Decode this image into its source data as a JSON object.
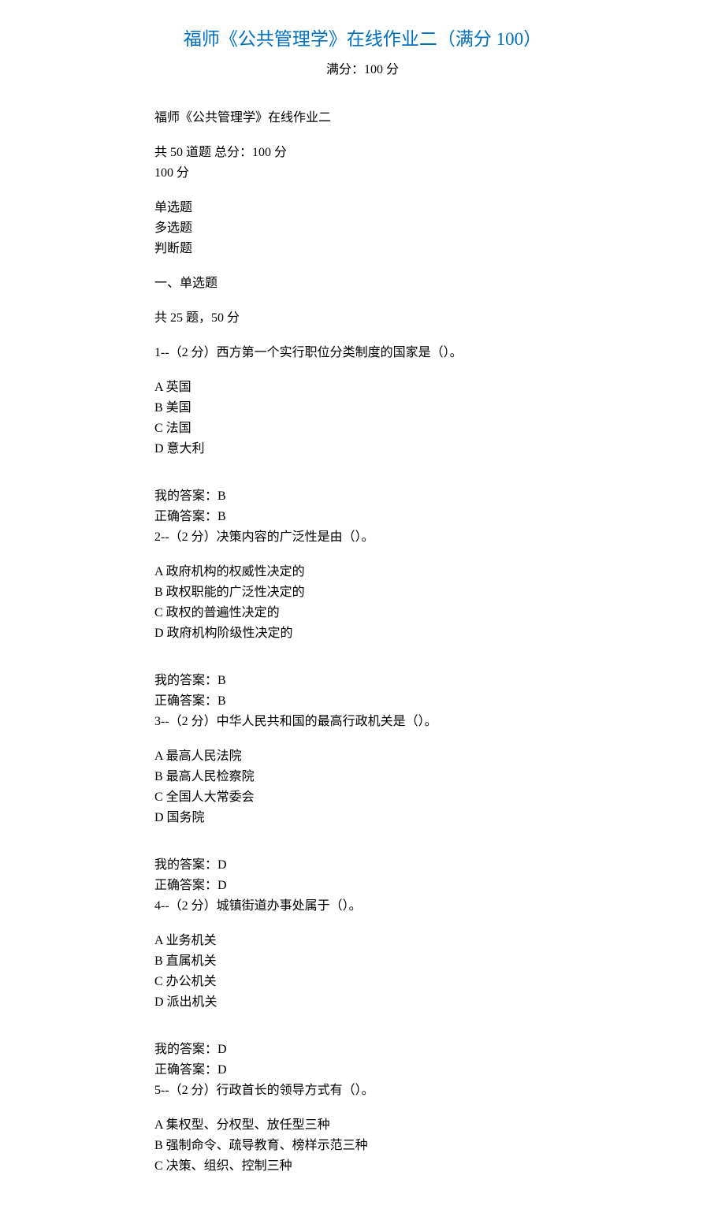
{
  "title": "福师《公共管理学》在线作业二（满分 100）",
  "subtitle": "满分：100 分",
  "intro": "福师《公共管理学》在线作业二",
  "summary": "共 50 道题  总分：100 分",
  "score_line": "100 分",
  "types": [
    "单选题",
    "多选题",
    "判断题"
  ],
  "section1_title": "一、单选题",
  "section1_sub": "共 25 题，50 分",
  "questions": [
    {
      "stem": "1--（2 分）西方第一个实行职位分类制度的国家是（）。",
      "options": [
        "A 英国",
        "B 美国",
        "C 法国",
        "D 意大利"
      ],
      "my": "我的答案：B",
      "correct": "正确答案：B"
    },
    {
      "stem": "2--（2 分）决策内容的广泛性是由（）。",
      "options": [
        "A 政府机构的权威性决定的",
        "B 政权职能的广泛性决定的",
        "C 政权的普遍性决定的",
        "D 政府机构阶级性决定的"
      ],
      "my": "我的答案：B",
      "correct": "正确答案：B"
    },
    {
      "stem": "3--（2 分）中华人民共和国的最高行政机关是（）。",
      "options": [
        "A 最高人民法院",
        "B 最高人民检察院",
        "C 全国人大常委会",
        "D 国务院"
      ],
      "my": "我的答案：D",
      "correct": "正确答案：D"
    },
    {
      "stem": "4--（2 分）城镇街道办事处属于（）。",
      "options": [
        "A 业务机关",
        "B 直属机关",
        "C 办公机关",
        "D 派出机关"
      ],
      "my": "我的答案：D",
      "correct": "正确答案：D"
    },
    {
      "stem": "5--（2 分）行政首长的领导方式有（）。",
      "options": [
        "A 集权型、分权型、放任型三种",
        "B 强制命令、疏导教育、榜样示范三种",
        "C 决策、组织、控制三种"
      ],
      "my": null,
      "correct": null
    }
  ]
}
